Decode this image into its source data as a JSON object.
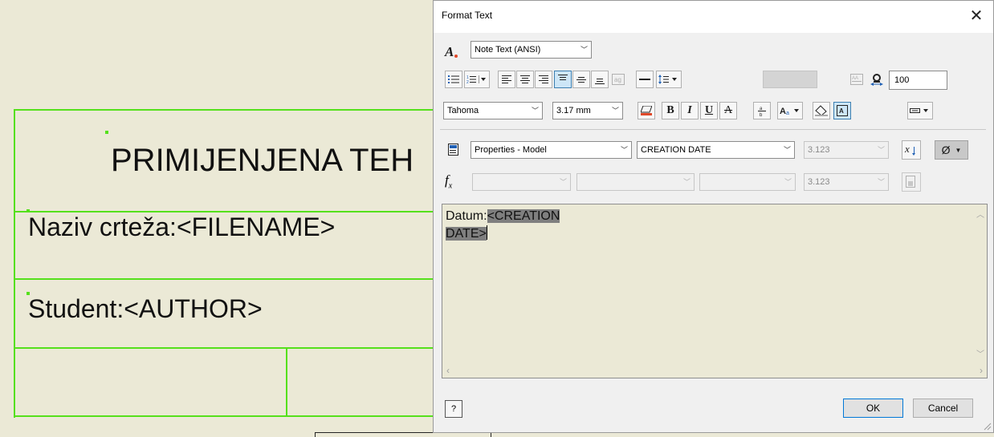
{
  "drawing": {
    "title_block_heading": "PRIMIJENJENA TEH",
    "drawing_name_field": "Naziv crteža:<FILENAME>",
    "student_field": "Student:<AUTHOR>"
  },
  "dialog": {
    "title": "Format Text",
    "close_glyph": "✕",
    "style": {
      "value": "Note Text (ANSI)"
    },
    "font": {
      "value": "Tahoma"
    },
    "font_size": {
      "value": "3.17 mm"
    },
    "bold_label": "B",
    "italic_label": "I",
    "underline_label": "U",
    "strike_label": "A",
    "width_scale": {
      "value": "100"
    },
    "properties_type": {
      "value": "Properties - Model"
    },
    "property": {
      "value": "CREATION DATE"
    },
    "precision1": {
      "value": "3.123"
    },
    "precision2": {
      "value": "3.123"
    },
    "fx_label": "f",
    "fx_sub": "x",
    "symbol_label": "Ø",
    "editor": {
      "prefix": "Datum:",
      "highlight_line1": "<CREATION",
      "highlight_line2": "DATE>"
    },
    "ok_label": "OK",
    "cancel_label": "Cancel",
    "help_label": "?"
  },
  "colors": {
    "canvas_bg": "#ebe9d6",
    "border_green": "#55e01c",
    "selection_blue": "#cde6f7",
    "highlight_gray": "#7f7f7f"
  }
}
